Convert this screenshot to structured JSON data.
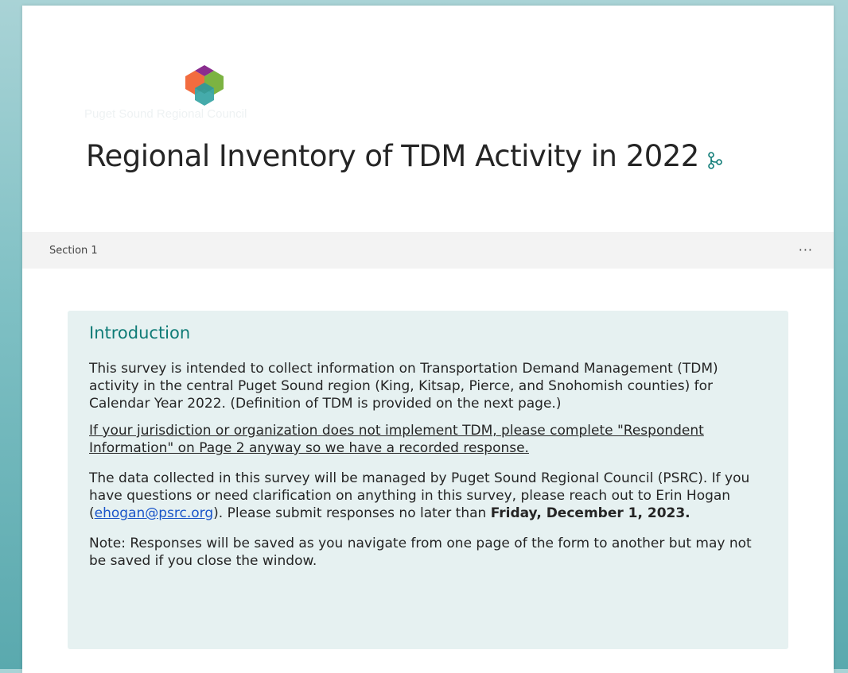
{
  "brand": {
    "org_name": "Puget Sound Regional Council",
    "logo_colors": [
      "#8a2d8e",
      "#f26c3f",
      "#7cb342",
      "#3ba7a6"
    ]
  },
  "form": {
    "title": "Regional Inventory of TDM Activity in 2022",
    "title_icon": "branch-icon"
  },
  "section": {
    "label": "Section 1",
    "more_label": "···"
  },
  "intro": {
    "heading": "Introduction",
    "p1": "This survey is intended to collect information on Transportation Demand Management (TDM) activity in the central Puget Sound region (King, Kitsap, Pierce, and Snohomish counties) for Calendar Year 2022. (Definition of TDM is provided on the next page.)",
    "p2": "If your jurisdiction or organization does not implement TDM, please complete \"Respondent Information\" on Page 2 anyway so we have a recorded response.",
    "p3_a": "The data collected in this survey will be managed by Puget Sound Regional Council (PSRC). If you have questions or need clarification on anything in this survey, please reach out to Erin Hogan (",
    "p3_email": "ehogan@psrc.org",
    "p3_b": "). Please submit responses no later than ",
    "p3_deadline": "Friday, December 1, 2023.",
    "p4": "Note: Responses will be saved as you navigate from one page of the form to another but may not be saved if you close the window."
  },
  "colors": {
    "accent": "#0e7b76",
    "intro_bg": "#e6f1f1",
    "link": "#1a55c9"
  }
}
